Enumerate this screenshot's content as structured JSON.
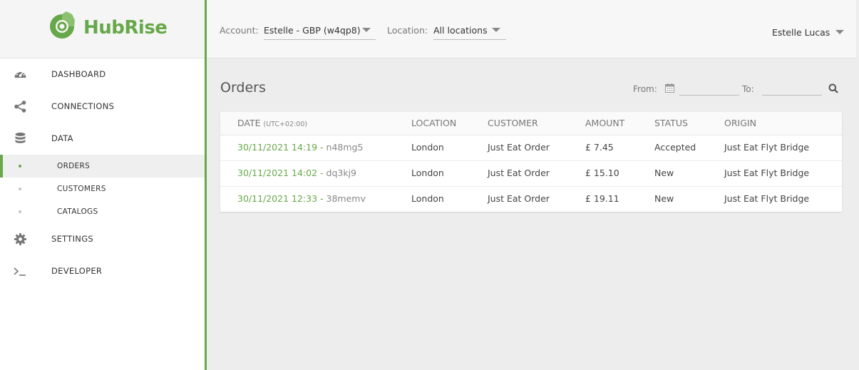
{
  "app": {
    "name": "HubRise",
    "brand_color": "#67a84a"
  },
  "sidebar": {
    "items": [
      {
        "label": "DASHBOARD",
        "icon": "gauge-icon"
      },
      {
        "label": "CONNECTIONS",
        "icon": "share-icon"
      },
      {
        "label": "DATA",
        "icon": "database-icon"
      }
    ],
    "subitems": [
      {
        "label": "ORDERS",
        "active": true
      },
      {
        "label": "CUSTOMERS",
        "active": false
      },
      {
        "label": "CATALOGS",
        "active": false
      }
    ],
    "bottom_items": [
      {
        "label": "SETTINGS",
        "icon": "gear-icon"
      },
      {
        "label": "DEVELOPER",
        "icon": "terminal-icon"
      }
    ]
  },
  "topbar": {
    "account_label": "Account:",
    "account_value": "Estelle - GBP (w4qp8)",
    "location_label": "Location:",
    "location_value": "All locations",
    "user_name": "Estelle Lucas"
  },
  "main": {
    "title": "Orders",
    "from_label": "From:",
    "to_label": "To:",
    "from_value": "",
    "to_value": ""
  },
  "table": {
    "headers": {
      "date": "DATE",
      "date_tz": "(UTC+02:00)",
      "location": "LOCATION",
      "customer": "CUSTOMER",
      "amount": "AMOUNT",
      "status": "STATUS",
      "origin": "ORIGIN"
    },
    "rows": [
      {
        "date": "30/11/2021 14:19",
        "order_id": "n48mg5",
        "location": "London",
        "customer": "Just Eat Order",
        "amount": "£ 7.45",
        "status": "Accepted",
        "origin": "Just Eat Flyt Bridge"
      },
      {
        "date": "30/11/2021 14:02",
        "order_id": "dq3kj9",
        "location": "London",
        "customer": "Just Eat Order",
        "amount": "£ 15.10",
        "status": "New",
        "origin": "Just Eat Flyt Bridge"
      },
      {
        "date": "30/11/2021 12:33",
        "order_id": "38memv",
        "location": "London",
        "customer": "Just Eat Order",
        "amount": "£ 19.11",
        "status": "New",
        "origin": "Just Eat Flyt Bridge"
      }
    ]
  }
}
